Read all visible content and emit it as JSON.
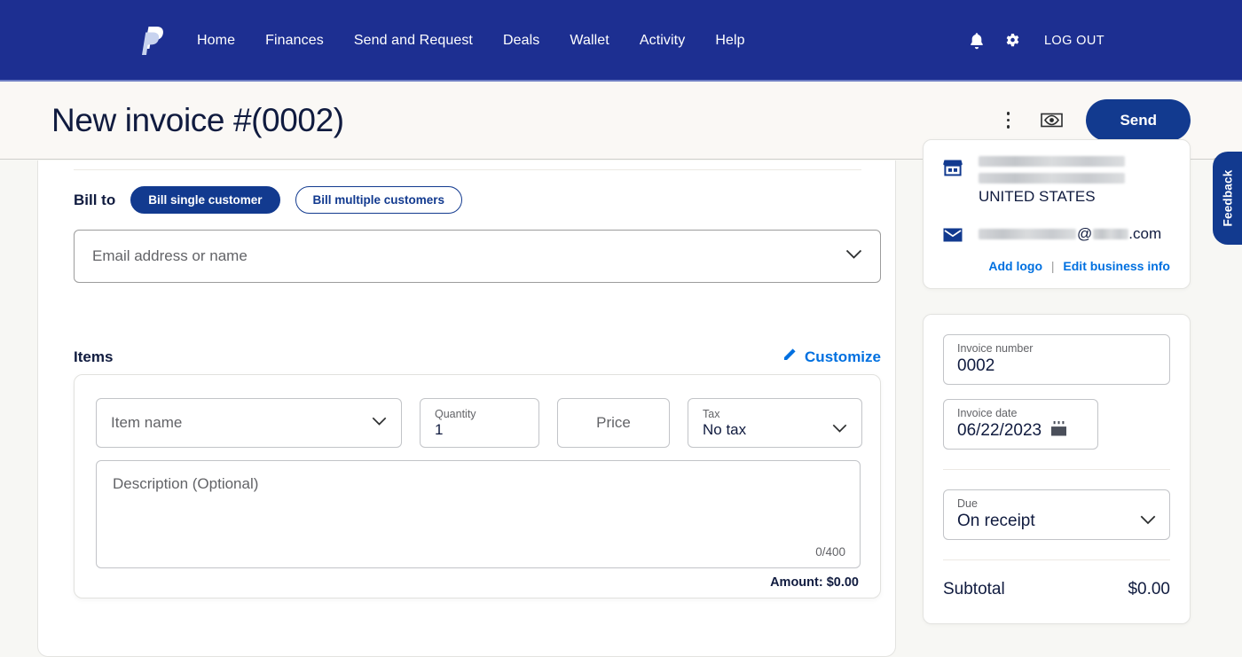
{
  "navbar": {
    "logo_icon": "paypal-logo-icon",
    "links": [
      {
        "label": "Home"
      },
      {
        "label": "Finances"
      },
      {
        "label": "Send and Request"
      },
      {
        "label": "Deals"
      },
      {
        "label": "Wallet"
      },
      {
        "label": "Activity"
      },
      {
        "label": "Help"
      }
    ],
    "notifications_icon": "bell-icon",
    "settings_icon": "gear-icon",
    "logout_label": "LOG OUT",
    "background": "#1d2f91"
  },
  "header": {
    "title": "New invoice #(0002)",
    "more_icon": "kebab-menu-icon",
    "preview_icon": "eye-preview-icon",
    "send_label": "Send",
    "send_color": "#123a8f",
    "background": "#faf8f5"
  },
  "bill_to": {
    "label": "Bill to",
    "options": [
      {
        "label": "Bill single customer",
        "selected": true
      },
      {
        "label": "Bill multiple customers",
        "selected": false
      }
    ],
    "customer_placeholder": "Email address or name",
    "chevron_icon": "chevron-down-icon"
  },
  "items": {
    "title": "Items",
    "customize_label": "Customize",
    "customize_icon": "pencil-icon",
    "row": {
      "item_name_placeholder": "Item name",
      "quantity_label": "Quantity",
      "quantity_value": "1",
      "price_placeholder": "Price",
      "tax_label": "Tax",
      "tax_value": "No tax",
      "description_placeholder": "Description (Optional)",
      "description_counter": "0/400",
      "amount_line": "Amount: $0.00"
    }
  },
  "business": {
    "store_icon": "store-icon",
    "email_icon": "envelope-icon",
    "address_line_1": "",
    "address_line_2": "",
    "country": "UNITED STATES",
    "email_domain": ".com",
    "add_logo_label": "Add logo",
    "links_separator": "|",
    "edit_business_label": "Edit business info",
    "link_color": "#0070e0"
  },
  "invoice_details": {
    "invoice_number_label": "Invoice number",
    "invoice_number_value": "0002",
    "invoice_date_label": "Invoice date",
    "invoice_date_value": "06/22/2023",
    "calendar_icon": "calendar-icon",
    "due_label": "Due",
    "due_value": "On receipt",
    "due_chevron_icon": "chevron-down-icon",
    "subtotal_label": "Subtotal",
    "subtotal_value": "$0.00"
  },
  "feedback": {
    "label": "Feedback"
  }
}
